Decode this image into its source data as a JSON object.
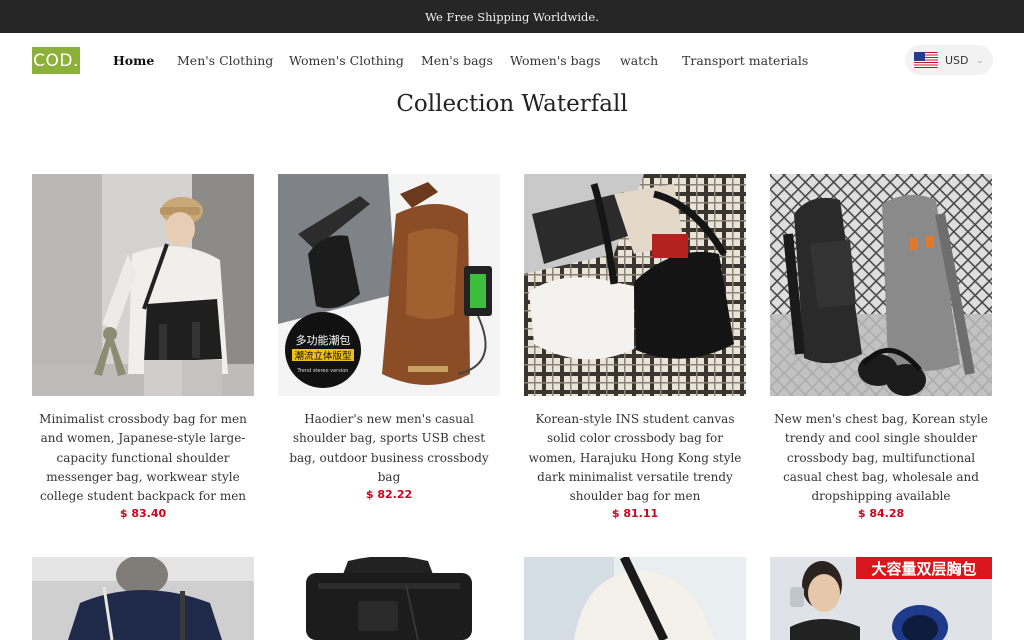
{
  "announcement": "We Free Shipping Worldwide.",
  "logo": "COD.",
  "nav": [
    {
      "label": "Home"
    },
    {
      "label": "Men's Clothing"
    },
    {
      "label": "Women's Clothing"
    },
    {
      "label": "Men's bags"
    },
    {
      "label": "Women's bags"
    },
    {
      "label": "watch"
    },
    {
      "label": "Transport materials"
    }
  ],
  "currency": {
    "code": "USD",
    "flag_icon": "us-flag-icon"
  },
  "page_title": "Collection Waterfall",
  "products": [
    {
      "name": "Minimalist crossbody bag for men and women, Japanese-style large-capacity functional shoulder messenger bag, workwear style college student backpack for men",
      "price": "$ 83.40"
    },
    {
      "name": "Haodier's new men's casual shoulder bag, sports USB chest bag, outdoor business crossbody bag",
      "price": "$ 82.22",
      "badge_line1": "多功能潮包",
      "badge_line2": "潮流立体版型",
      "badge_line3": "Trend stereo version"
    },
    {
      "name": "Korean-style INS student canvas solid color crossbody bag for women, Harajuku Hong Kong style dark minimalist versatile trendy shoulder bag for men",
      "price": "$ 81.11"
    },
    {
      "name": "New men's chest bag, Korean style trendy and cool single shoulder crossbody bag, multifunctional casual chest bag, wholesale and dropshipping available",
      "price": "$ 84.28"
    }
  ],
  "products_row2": [
    {
      "banner": ""
    },
    {
      "banner": ""
    },
    {
      "banner": ""
    },
    {
      "banner": "大容量双层胸包"
    }
  ],
  "colors": {
    "brand": "#8cb03a",
    "price": "#d0021b",
    "topbar": "#262626"
  }
}
